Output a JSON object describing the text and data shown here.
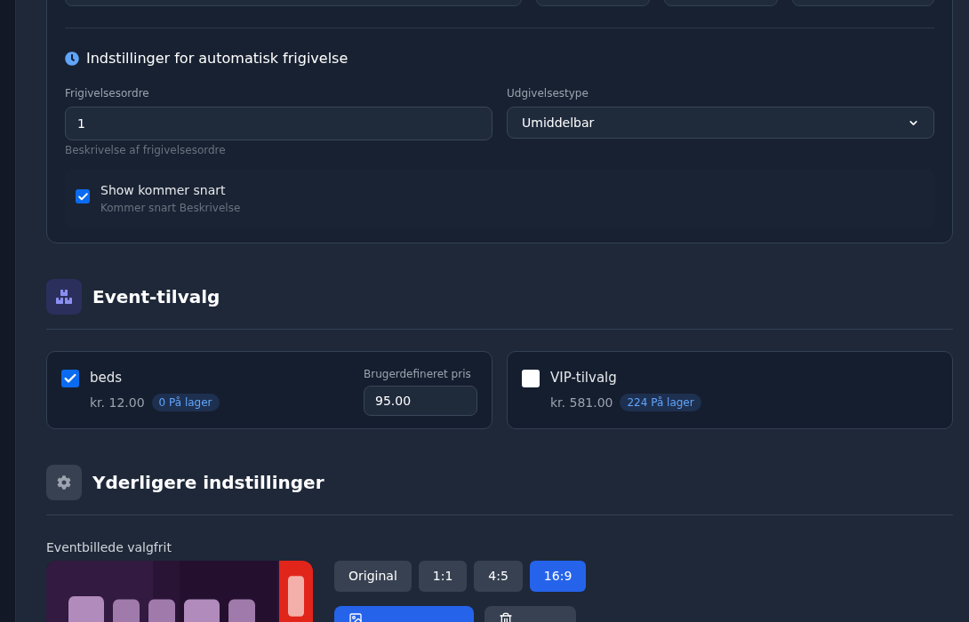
{
  "release": {
    "title": "Indstillinger for automatisk frigivelse",
    "order_field": {
      "label": "Frigivelsesordre",
      "value": "1",
      "help": "Beskrivelse af frigivelsesordre"
    },
    "type_select": {
      "label": "Udgivelsestype",
      "value": "Umiddelbar"
    },
    "coming_soon": {
      "label": "Show kommer snart",
      "description": "Kommer snart Beskrivelse",
      "checked": true
    }
  },
  "addons": {
    "title": "Event-tilvalg",
    "items": [
      {
        "name": "beds",
        "price": "kr. 12.00",
        "stock": "0 På lager",
        "checked": true,
        "custom_price_label": "Brugerdefineret pris",
        "custom_price": "95.00"
      },
      {
        "name": "VIP-tilvalg",
        "price": "kr. 581.00",
        "stock": "224 På lager",
        "checked": false
      }
    ]
  },
  "more": {
    "title": "Yderligere indstillinger",
    "image_label": "Eventbillede valgfrit",
    "aspect_ratios": [
      {
        "label": "Original",
        "selected": false
      },
      {
        "label": "1:1",
        "selected": false
      },
      {
        "label": "4:5",
        "selected": false
      },
      {
        "label": "16:9",
        "selected": true
      }
    ]
  }
}
